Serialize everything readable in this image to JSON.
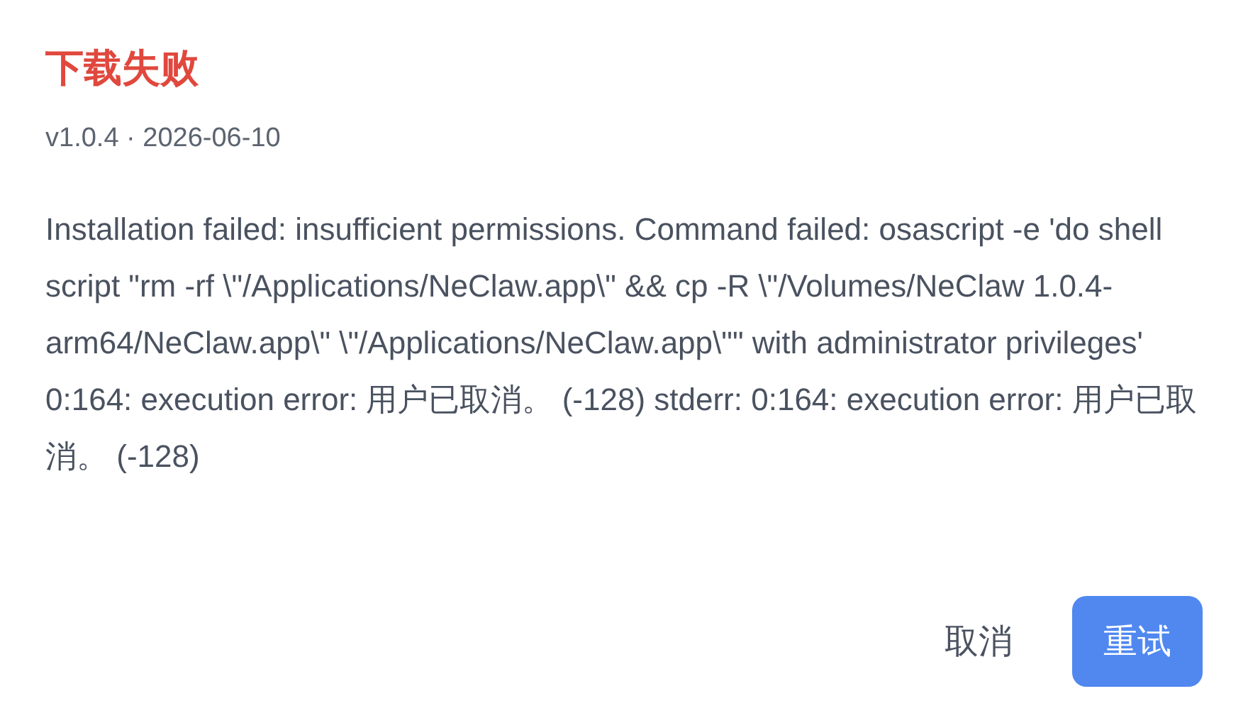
{
  "dialog": {
    "title": "下载失败",
    "subtitle": "v1.0.4 · 2026-06-10",
    "message": "Installation failed: insufficient permissions. Command failed: osascript -e 'do shell script \"rm -rf \\\"/Applications/NeClaw.app\\\" && cp -R \\\"/Volumes/NeClaw 1.0.4-arm64/NeClaw.app\\\" \\\"/Applications/NeClaw.app\\\"\" with administrator privileges' 0:164: execution error: 用户已取消。 (-128) stderr: 0:164: execution error: 用户已取消。 (-128)",
    "buttons": [
      {
        "label": "取消",
        "kind": "secondary"
      },
      {
        "label": "重试",
        "kind": "primary"
      }
    ]
  }
}
